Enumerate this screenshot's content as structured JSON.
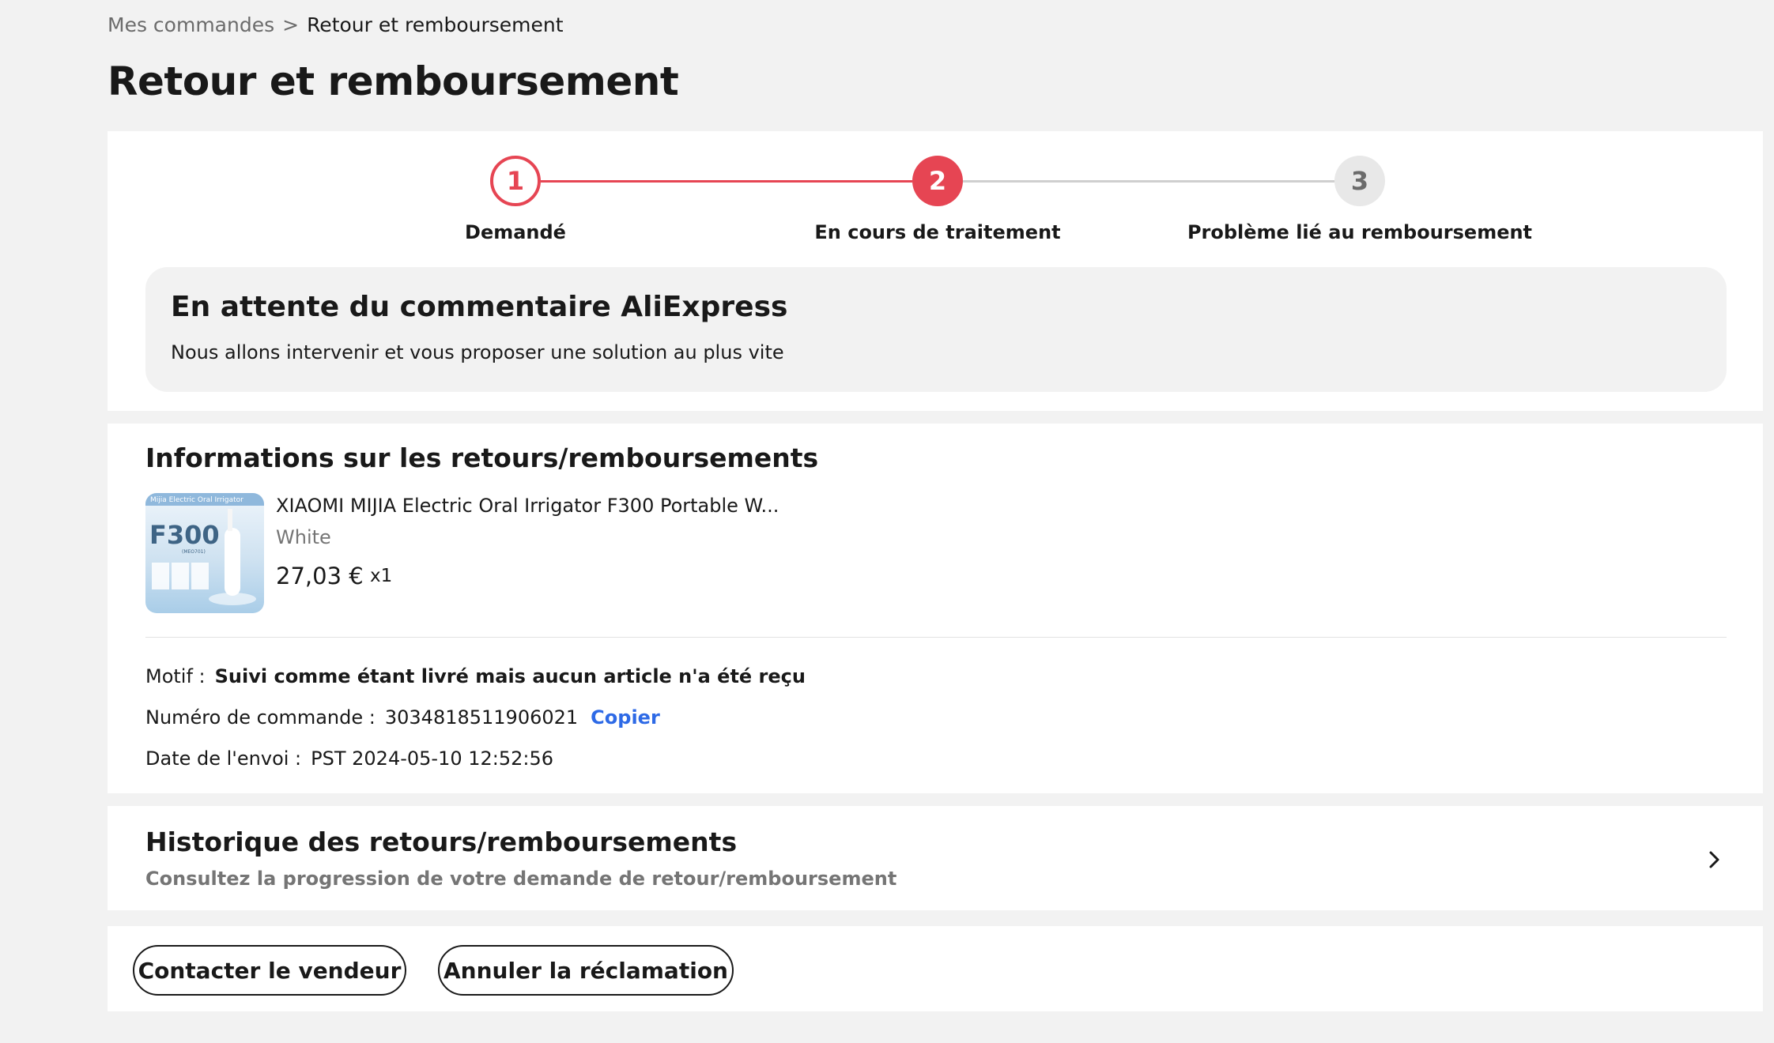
{
  "breadcrumb": {
    "parent": "Mes commandes",
    "separator": ">",
    "current": "Retour et remboursement"
  },
  "page": {
    "title": "Retour et remboursement"
  },
  "steps": [
    {
      "number": "1",
      "label": "Demandé",
      "state": "done"
    },
    {
      "number": "2",
      "label": "En cours de traitement",
      "state": "current"
    },
    {
      "number": "3",
      "label": "Problème lié au remboursement",
      "state": "pending"
    }
  ],
  "status": {
    "title": "En attente du commentaire AliExpress",
    "subtitle": "Nous allons intervenir et vous proposer une solution au plus vite"
  },
  "info": {
    "title": "Informations sur les retours/remboursements",
    "product": {
      "name": "XIAOMI MIJIA Electric Oral Irrigator F300 Portable W...",
      "variant": "White",
      "price": "27,03 €",
      "quantity": "x1",
      "thumb_banner": "Mijia Electric Oral Irrigator",
      "thumb_model": "F300",
      "thumb_code": "(MEO701)"
    },
    "motif_label": "Motif :",
    "motif_value": "Suivi comme étant livré mais aucun article n'a été reçu",
    "order_label": "Numéro de commande :",
    "order_value": "3034818511906021",
    "copy_label": "Copier",
    "date_label": "Date de l'envoi :",
    "date_value": "PST 2024-05-10 12:52:56"
  },
  "history": {
    "title": "Historique des retours/remboursements",
    "subtitle": "Consultez la progression de votre demande de retour/remboursement",
    "icon": "chevron-right-icon"
  },
  "actions": {
    "contact_label": "Contacter le vendeur",
    "cancel_label": "Annuler la réclamation"
  },
  "colors": {
    "accent": "#e64553",
    "link": "#2e6ae6",
    "background": "#f2f2f2"
  }
}
